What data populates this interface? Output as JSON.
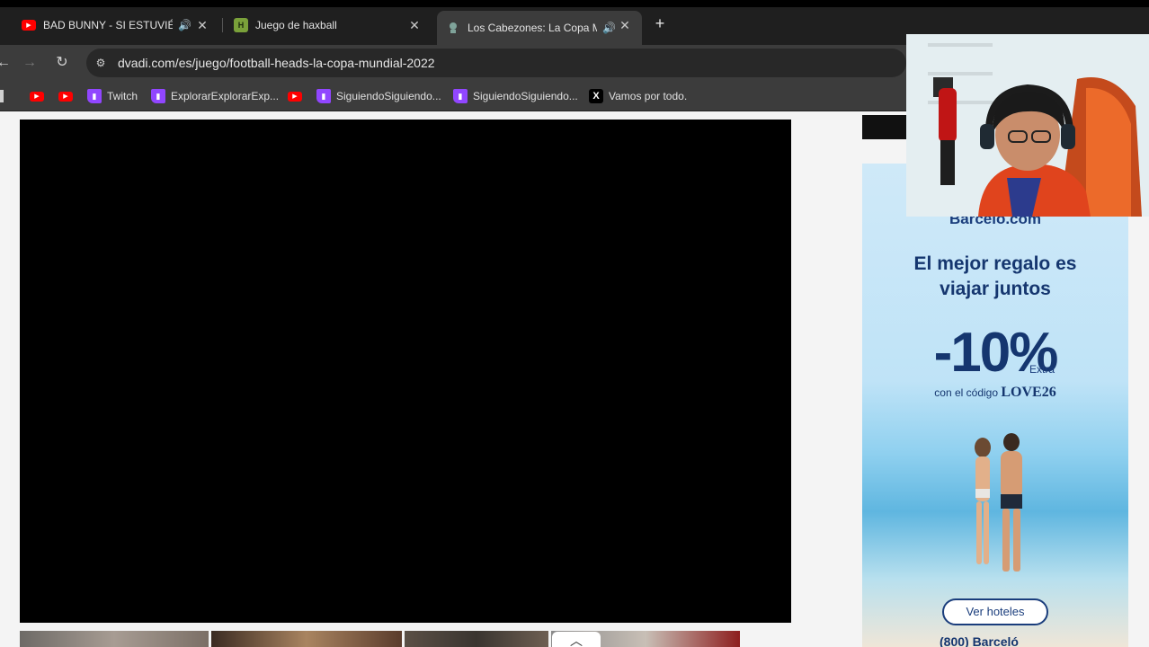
{
  "browser": {
    "tabs": [
      {
        "title": "BAD BUNNY - SI ESTUVIÉSE",
        "favicon": "youtube-icon",
        "audio": true,
        "active": false
      },
      {
        "title": "Juego de haxball",
        "favicon": "haxball-icon",
        "audio": false,
        "active": false
      },
      {
        "title": "Los Cabezones: La Copa Mu",
        "favicon": "dvadi-icon",
        "audio": true,
        "active": true
      }
    ],
    "url": "dvadi.com/es/juego/football-heads-la-copa-mundial-2022",
    "bookmarks": [
      {
        "label": "",
        "icon": "youtube-icon"
      },
      {
        "label": "",
        "icon": "youtube-icon"
      },
      {
        "label": "Twitch",
        "icon": "twitch-icon"
      },
      {
        "label": "ExplorarExplorarExp...",
        "icon": "twitch-icon"
      },
      {
        "label": "",
        "icon": "youtube-icon"
      },
      {
        "label": "SiguiendoSiguiendo...",
        "icon": "twitch-icon"
      },
      {
        "label": "SiguiendoSiguiendo...",
        "icon": "twitch-icon"
      },
      {
        "label": "Vamos por todo.",
        "icon": "x-icon"
      }
    ]
  },
  "ad": {
    "brand": "Barceló.com",
    "headline": "El mejor regalo es viajar juntos",
    "discount": "-10%",
    "discount_extra": "Extra",
    "code_prefix": "con el código",
    "code": "LOVE26",
    "cta": "Ver hoteles",
    "phone": "(800) Barceló",
    "brand_color": "#15366f"
  },
  "colors": {
    "tabstrip": "#1f1f1f",
    "toolbar": "#3c3c3c",
    "game_background": "#000000",
    "page_background": "#f4f4f4"
  }
}
